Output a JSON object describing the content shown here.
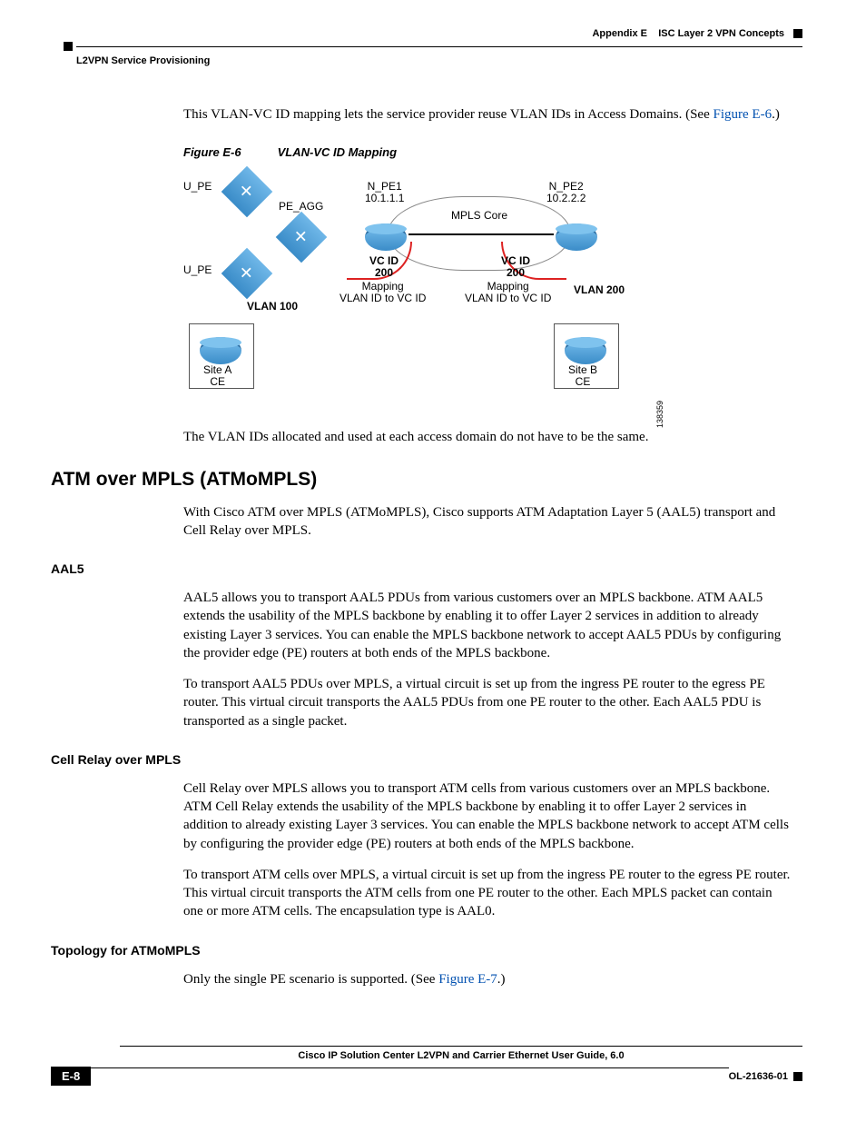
{
  "header": {
    "appendix": "Appendix E",
    "appendix_title": "ISC Layer 2 VPN Concepts",
    "section": "L2VPN Service Provisioning"
  },
  "intro": {
    "p1_a": "This VLAN-VC ID mapping lets the service provider reuse VLAN IDs in Access Domains. (See ",
    "p1_link": "Figure E-6",
    "p1_b": ".)"
  },
  "figure": {
    "num": "Figure E-6",
    "title": "VLAN-VC ID Mapping",
    "labels": {
      "u_pe": "U_PE",
      "pe_agg": "PE_AGG",
      "n_pe1": "N_PE1",
      "n_pe1_ip": "10.1.1.1",
      "n_pe2": "N_PE2",
      "n_pe2_ip": "10.2.2.2",
      "mpls_core": "MPLS Core",
      "vc_id": "VC ID",
      "vc_200": "200",
      "mapping1": "Mapping",
      "mapping2": "VLAN ID to VC ID",
      "vlan100": "VLAN 100",
      "vlan200": "VLAN 200",
      "site_a": "Site A",
      "site_b": "Site B",
      "ce": "CE",
      "imgid": "138359"
    },
    "caption_below": "The VLAN IDs allocated and used at each access domain do not have to be the same."
  },
  "atmompls": {
    "h1": "ATM over MPLS (ATMoMPLS)",
    "p1": "With Cisco ATM over MPLS (ATMoMPLS), Cisco supports ATM Adaptation Layer 5 (AAL5) transport and Cell Relay over MPLS."
  },
  "aal5": {
    "h2": "AAL5",
    "p1": "AAL5 allows you to transport AAL5 PDUs from various customers over an MPLS backbone. ATM AAL5 extends the usability of the MPLS backbone by enabling it to offer Layer 2 services in addition to already existing Layer 3 services. You can enable the MPLS backbone network to accept AAL5 PDUs by configuring the provider edge (PE) routers at both ends of the MPLS backbone.",
    "p2": "To transport AAL5 PDUs over MPLS, a virtual circuit is set up from the ingress PE router to the egress PE router. This virtual circuit transports the AAL5 PDUs from one PE router to the other. Each AAL5 PDU is transported as a single packet."
  },
  "cellrelay": {
    "h2": "Cell Relay over MPLS",
    "p1": "Cell Relay over MPLS allows you to transport ATM cells from various customers over an MPLS backbone. ATM Cell Relay extends the usability of the MPLS backbone by enabling it to offer Layer 2 services in addition to already existing Layer 3 services. You can enable the MPLS backbone network to accept ATM cells by configuring the provider edge (PE) routers at both ends of the MPLS backbone.",
    "p2": "To transport ATM cells over MPLS, a virtual circuit is set up from the ingress PE router to the egress PE router. This virtual circuit transports the ATM cells from one PE router to the other. Each MPLS packet can contain one or more ATM cells. The encapsulation type is AAL0."
  },
  "topology": {
    "h2": "Topology for ATMoMPLS",
    "p1_a": "Only the single PE scenario is supported. (See ",
    "p1_link": "Figure E-7",
    "p1_b": ".)"
  },
  "footer": {
    "book": "Cisco IP Solution Center L2VPN and Carrier Ethernet User Guide, 6.0",
    "page": "E-8",
    "docid": "OL-21636-01"
  }
}
